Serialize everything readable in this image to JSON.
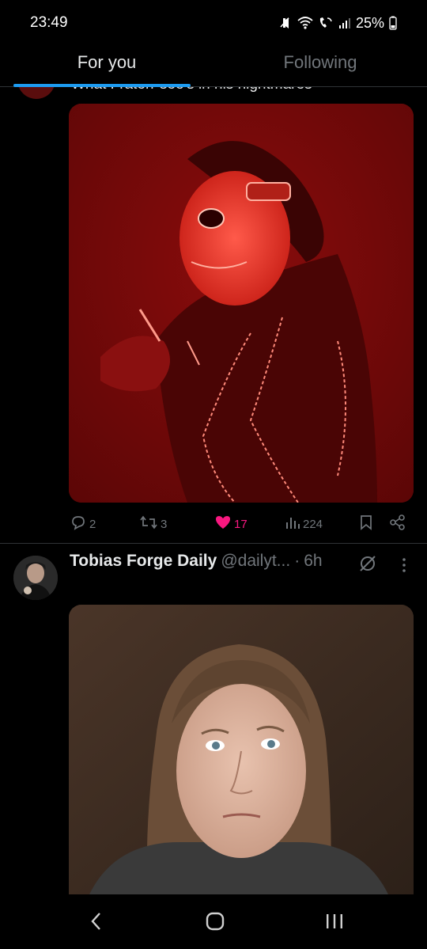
{
  "status_bar": {
    "time": "23:49",
    "battery": "25%",
    "icons": [
      "mute-icon",
      "wifi-icon",
      "wifi-call-icon",
      "signal-icon",
      "battery-icon"
    ]
  },
  "tabs": [
    {
      "label": "For you",
      "active": true
    },
    {
      "label": "Following",
      "active": false
    }
  ],
  "tweet1": {
    "text_partial": "What Fraterr see's in his nightmares",
    "actions": {
      "replies": "2",
      "retweets": "3",
      "likes": "17",
      "views": "224"
    },
    "media_icon": "red-masked-performer-image"
  },
  "tweet2": {
    "name": "Tobias Forge Daily",
    "handle": "@dailyt...",
    "separator": "·",
    "time": "6h",
    "icons": [
      "grok-icon",
      "more-icon"
    ],
    "media_icon": "long-haired-man-image"
  },
  "colors": {
    "accent": "#1d9bf0",
    "like": "#f91880",
    "muted": "#71767b",
    "text": "#e7e9ea",
    "border": "#2f3336"
  },
  "navbar": {
    "icons": [
      "back-icon",
      "home-icon",
      "recents-icon"
    ]
  }
}
